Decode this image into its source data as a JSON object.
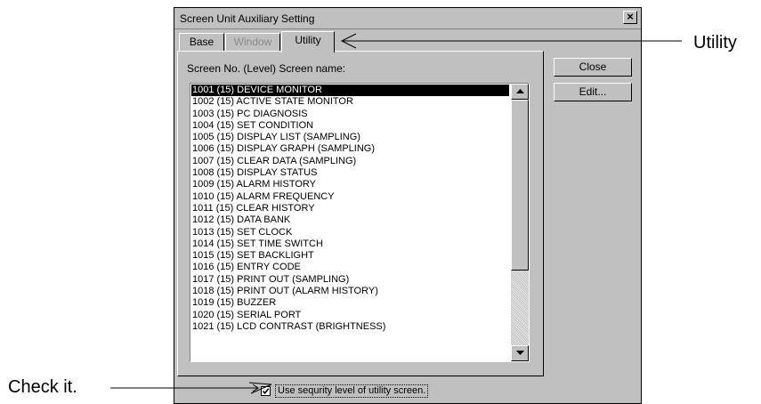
{
  "dialog": {
    "title": "Screen Unit Auxiliary Setting",
    "close_glyph": "×",
    "tabs": [
      {
        "label": "Base",
        "state": "normal"
      },
      {
        "label": "Window",
        "state": "disabled"
      },
      {
        "label": "Utility",
        "state": "active"
      }
    ],
    "list_header": "Screen No. (Level) Screen name:",
    "list_items": [
      "1001 (15) DEVICE MONITOR",
      "1002 (15) ACTIVE STATE MONITOR",
      "1003 (15) PC DIAGNOSIS",
      "1004 (15) SET CONDITION",
      "1005 (15) DISPLAY LIST (SAMPLING)",
      "1006 (15) DISPLAY GRAPH (SAMPLING)",
      "1007 (15) CLEAR DATA (SAMPLING)",
      "1008 (15) DISPLAY STATUS",
      "1009 (15) ALARM HISTORY",
      "1010 (15) ALARM FREQUENCY",
      "1011 (15) CLEAR HISTORY",
      "1012 (15) DATA BANK",
      "1013 (15) SET CLOCK",
      "1014 (15) SET TIME SWITCH",
      "1015 (15) SET BACKLIGHT",
      "1016 (15) ENTRY CODE",
      "1017 (15) PRINT OUT (SAMPLING)",
      "1018 (15) PRINT OUT (ALARM HISTORY)",
      "1019 (15) BUZZER",
      "1020 (15) SERIAL PORT",
      "1021 (15) LCD CONTRAST (BRIGHTNESS)"
    ],
    "selected_index": 0,
    "buttons": {
      "close": "Close",
      "edit": "Edit..."
    },
    "checkbox": {
      "label": "Use sequrity level of utility screen.",
      "checked": true
    }
  },
  "annotations": {
    "utility_callout": "Utility",
    "check_callout": "Check it."
  },
  "icons": [
    "close-icon",
    "scroll-up-arrow-icon",
    "scroll-down-arrow-icon",
    "checkmark-icon"
  ]
}
